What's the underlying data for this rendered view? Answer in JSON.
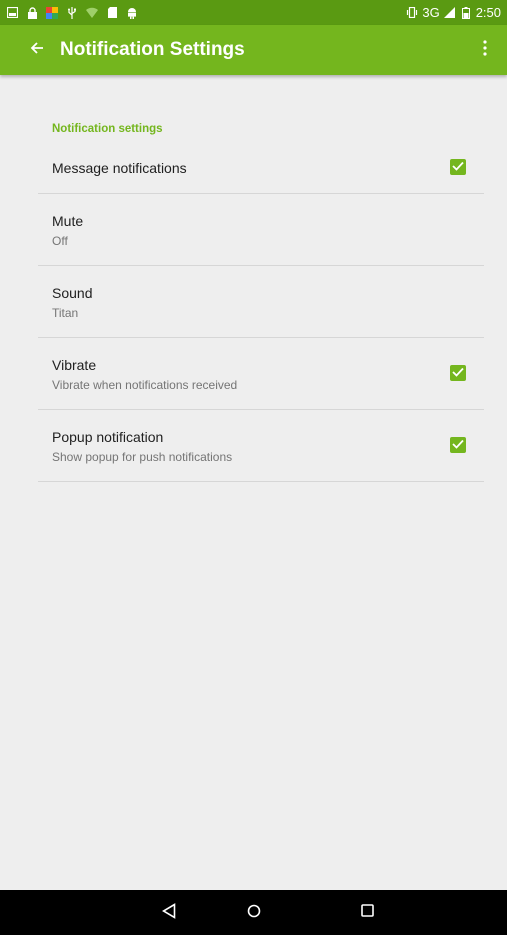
{
  "status_bar": {
    "network": "3G",
    "time": "2:50",
    "left_icons": [
      "image-icon",
      "lock-icon",
      "photos-icon",
      "usb-icon",
      "wifi-icon",
      "sd-card-icon",
      "android-icon"
    ],
    "right_icons": [
      "vibrate-icon",
      "signal-icon",
      "battery-icon"
    ]
  },
  "toolbar": {
    "title": "Notification Settings",
    "back_icon": "back-arrow-icon",
    "overflow_icon": "overflow-menu-icon"
  },
  "section": {
    "header": "Notification settings"
  },
  "preferences": [
    {
      "title": "Message notifications",
      "summary": "",
      "checkbox": true,
      "checked": true
    },
    {
      "title": "Mute",
      "summary": "Off",
      "checkbox": false
    },
    {
      "title": "Sound",
      "summary": "Titan",
      "checkbox": false
    },
    {
      "title": "Vibrate",
      "summary": "Vibrate when notifications received",
      "checkbox": true,
      "checked": true
    },
    {
      "title": "Popup notification",
      "summary": "Show popup for push notifications",
      "checkbox": true,
      "checked": true
    }
  ],
  "nav_bar": {
    "icons": [
      "back-triangle-icon",
      "home-circle-icon",
      "recents-square-icon"
    ]
  },
  "colors": {
    "accent": "#74b61e",
    "status_bar": "#5a9a12",
    "background": "#eeeeee"
  }
}
